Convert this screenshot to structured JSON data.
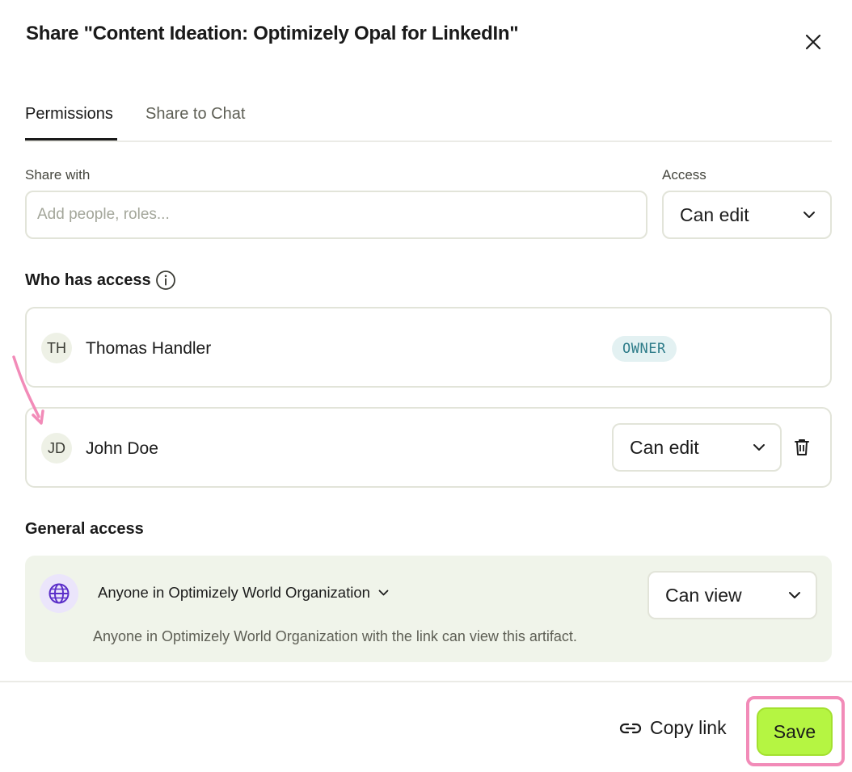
{
  "dialog": {
    "title": "Share \"Content Ideation: Optimizely Opal for LinkedIn\"",
    "close_icon": "close-icon"
  },
  "tabs": [
    {
      "label": "Permissions",
      "active": true
    },
    {
      "label": "Share to Chat",
      "active": false
    }
  ],
  "share": {
    "share_with_label": "Share with",
    "input_placeholder": "Add people, roles...",
    "input_value": "",
    "access_label": "Access",
    "access_value": "Can edit"
  },
  "who_has_access": {
    "title": "Who has access",
    "users": [
      {
        "initials": "TH",
        "name": "Thomas Handler",
        "role_badge": "OWNER"
      },
      {
        "initials": "JD",
        "name": "John Doe",
        "permission": "Can edit"
      }
    ]
  },
  "general_access": {
    "title": "General access",
    "org_select": "Anyone in Optimizely World Organization",
    "permission": "Can view",
    "description": "Anyone in Optimizely World Organization with the link can view this artifact."
  },
  "footer": {
    "copy_link_label": "Copy link",
    "save_label": "Save"
  },
  "colors": {
    "accent_save": "#b5f542",
    "highlight": "#f28bb8",
    "owner_badge_bg": "#e3f1f2",
    "owner_badge_text": "#2f7d8a",
    "general_box_bg": "#f0f4ea",
    "globe_bg": "#ebe5fb",
    "globe_icon": "#5b2fc9"
  }
}
